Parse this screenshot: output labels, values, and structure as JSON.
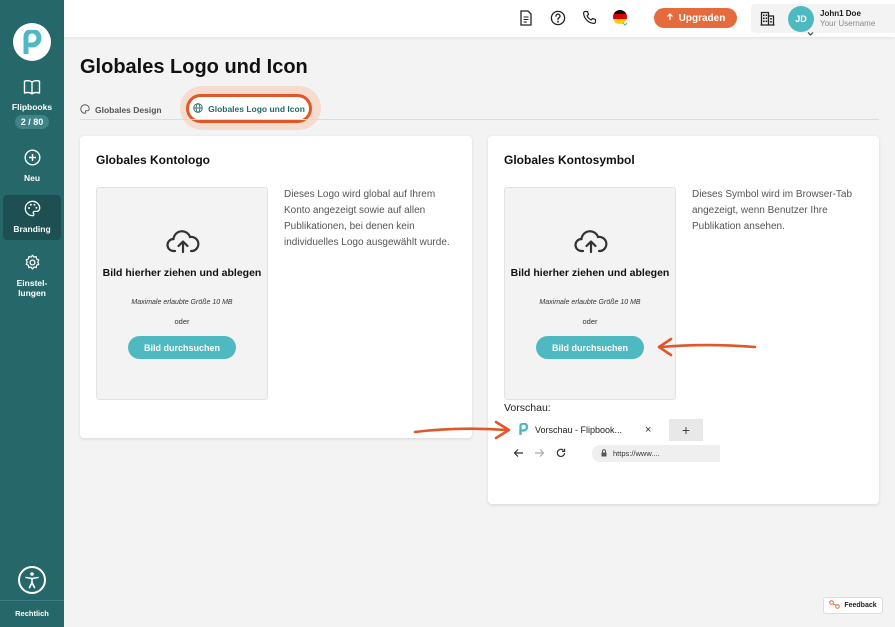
{
  "colors": {
    "sidebar": "#26676a",
    "accent": "#4fb9c2",
    "upgrade": "#e56a3c",
    "highlight": "#e0572a"
  },
  "sidebar": {
    "logo_icon": "brand-logo-icon",
    "items": [
      {
        "label": "Flipbooks",
        "icon": "book-icon",
        "badge": "2 / 80"
      },
      {
        "label": "Neu",
        "icon": "plus-circle-icon"
      },
      {
        "label": "Branding",
        "icon": "palette-icon",
        "active": true
      },
      {
        "label": "Einstel-lungen",
        "label_line1": "Einstel-",
        "label_line2": "lungen",
        "icon": "gear-icon"
      }
    ],
    "accessibility_icon": "accessibility-icon",
    "legal": "Rechtlich"
  },
  "topbar": {
    "icons": [
      "document-icon",
      "help-icon",
      "phone-icon",
      "germany-flag-icon"
    ],
    "upgrade_label": "Upgraden",
    "company_icon": "building-icon",
    "user": {
      "initials": "JD",
      "name": "John1 Doe",
      "username": "Your Username"
    }
  },
  "page": {
    "title": "Globales Logo und Icon",
    "tabs": [
      {
        "label": "Globales Design",
        "icon": "palette-icon"
      },
      {
        "label": "Globales Logo und Icon",
        "icon": "globe-icon",
        "active": true
      }
    ]
  },
  "cards": {
    "logo": {
      "title": "Globales Kontologo",
      "drop_title": "Bild hierher ziehen und ablegen",
      "max_size": "Maximale erlaubte Größe 10 MB",
      "or": "oder",
      "browse": "Bild durchsuchen",
      "description": "Dieses Logo wird global auf Ihrem Konto angezeigt sowie auf allen Publikationen, bei denen kein individuelles Logo ausgewählt wurde."
    },
    "symbol": {
      "title": "Globales Kontosymbol",
      "drop_title": "Bild hierher ziehen und ablegen",
      "max_size": "Maximale erlaubte Größe 10 MB",
      "or": "oder",
      "browse": "Bild durchsuchen",
      "description": "Dieses Symbol wird im Browser-Tab angezeigt, wenn Benutzer Ihre Publikation ansehen.",
      "preview_label": "Vorschau:",
      "preview_tab_title": "Vorschau - Flipbook...",
      "preview_close": "×",
      "preview_new_tab": "+",
      "preview_url": "https://www...."
    }
  },
  "feedback_label": "Feedback"
}
